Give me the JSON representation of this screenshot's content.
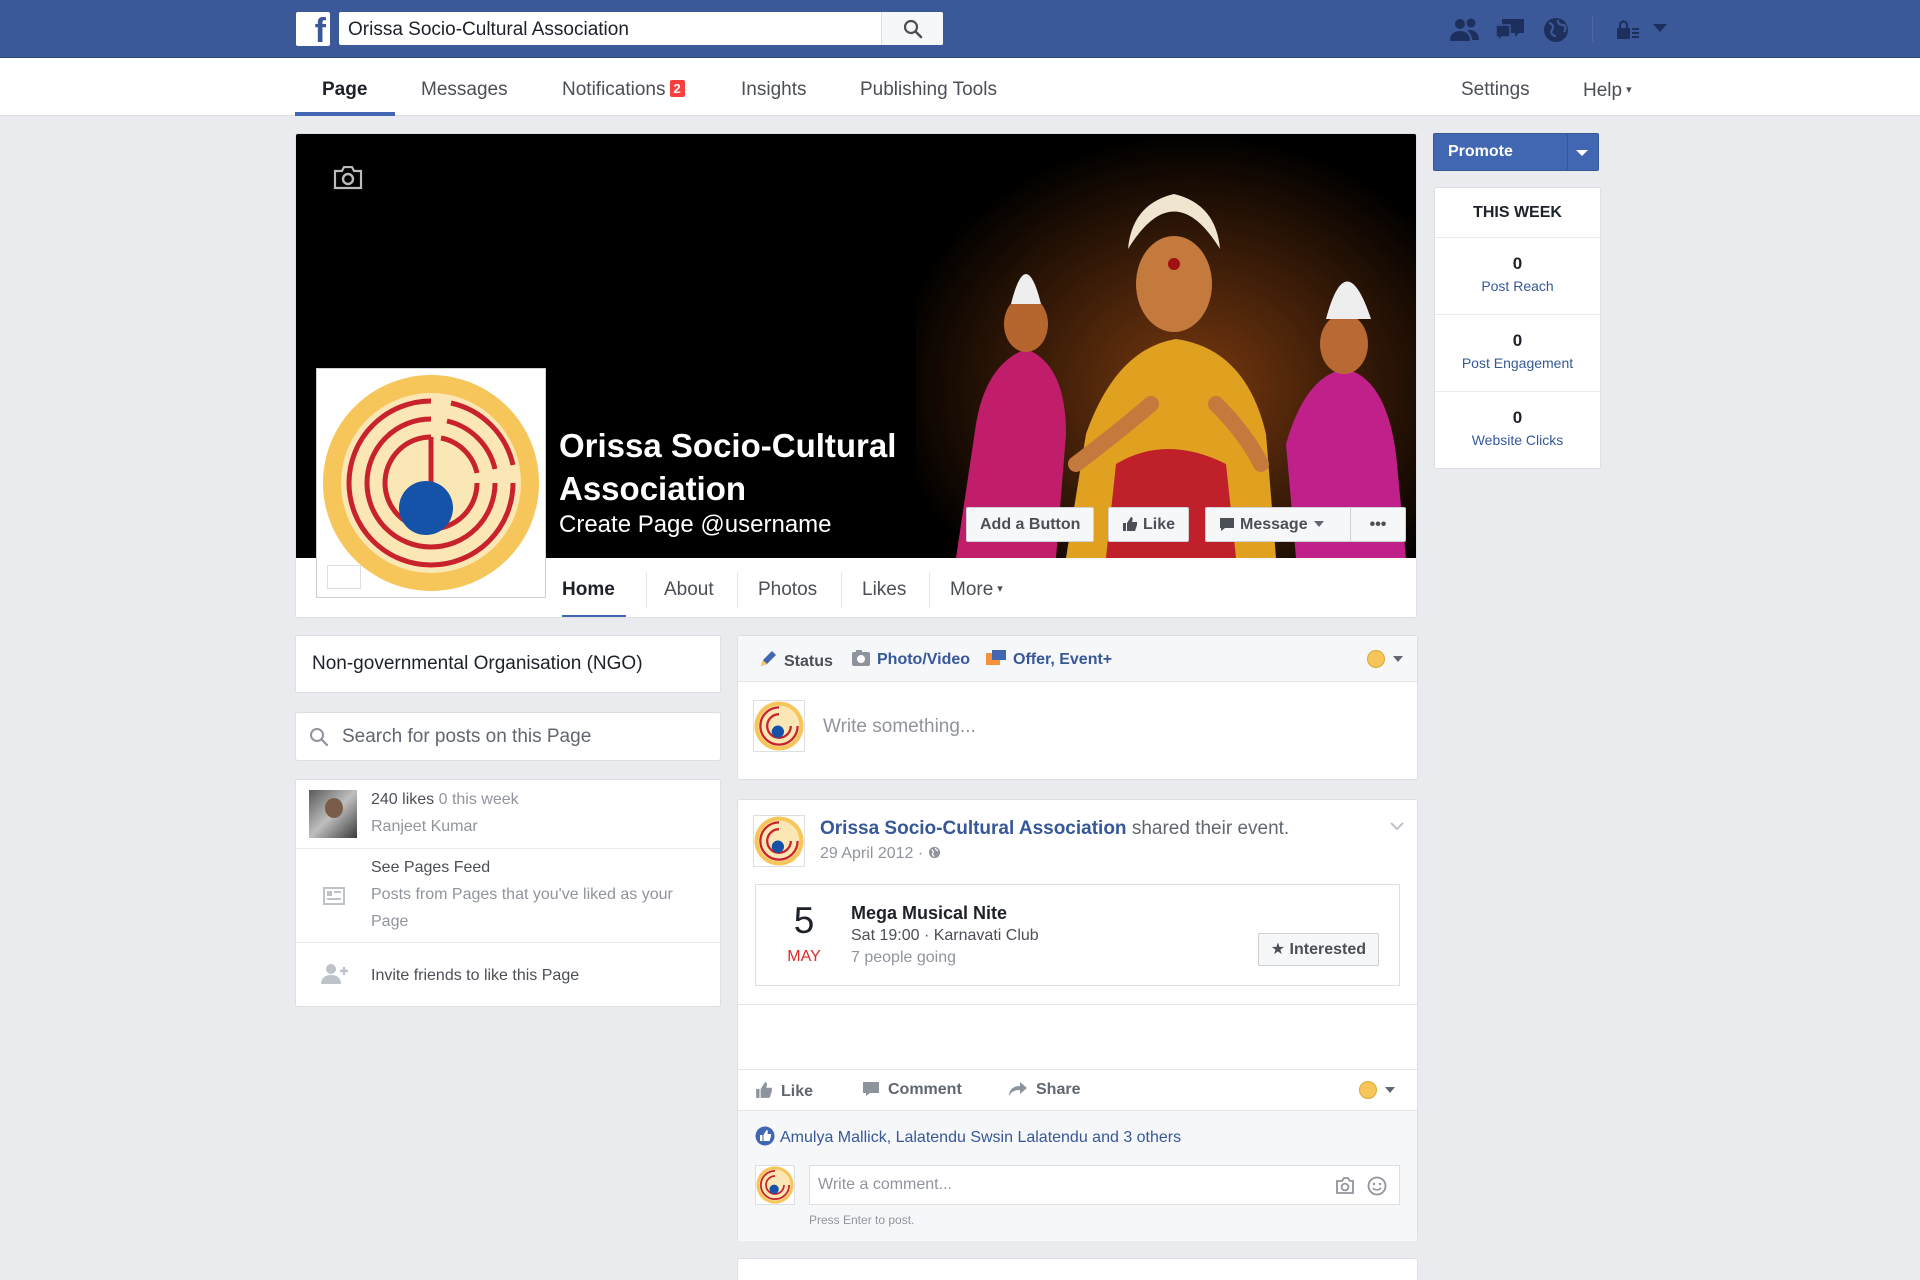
{
  "topbar": {
    "logo": "f",
    "search_value": "Orissa Socio-Cultural Association",
    "icons": [
      "friends-icon",
      "messages-icon",
      "globe-icon",
      "privacy-icon",
      "account-menu-icon"
    ]
  },
  "nav": {
    "tabs": [
      {
        "label": "Page",
        "active": true
      },
      {
        "label": "Messages"
      },
      {
        "label": "Notifications",
        "badge": "2"
      },
      {
        "label": "Insights"
      },
      {
        "label": "Publishing Tools"
      }
    ],
    "settings": "Settings",
    "help": "Help",
    "help_caret": "▾"
  },
  "cover": {
    "title": "Orissa Socio-Cultural Association",
    "username_cta": "Create Page @username",
    "buttons": {
      "add_button": "Add a Button",
      "like": "Like",
      "message": "Message",
      "more": "•••"
    }
  },
  "page_tabs": [
    {
      "label": "Home",
      "active": true
    },
    {
      "label": "About"
    },
    {
      "label": "Photos"
    },
    {
      "label": "Likes"
    },
    {
      "label": "More"
    }
  ],
  "page_tabs_caret": "▾",
  "right": {
    "promote": "Promote",
    "week_header": "THIS WEEK",
    "stats": [
      {
        "value": "0",
        "label": "Post Reach"
      },
      {
        "value": "0",
        "label": "Post Engagement"
      },
      {
        "value": "0",
        "label": "Website Clicks"
      }
    ]
  },
  "left": {
    "category": "Non-governmental Organisation (NGO)",
    "search_placeholder": "Search for posts on this Page",
    "likes_count": "240 likes",
    "likes_week": "0 this week",
    "liker": "Ranjeet Kumar",
    "feed_title": "See Pages Feed",
    "feed_desc": "Posts from Pages that you've liked as your Page",
    "invite": "Invite friends to like this Page"
  },
  "composer": {
    "status": "Status",
    "photo_video": "Photo/Video",
    "offer_event": "Offer, Event+",
    "placeholder": "Write something..."
  },
  "post": {
    "author": "Orissa Socio-Cultural Association",
    "action": "shared their event.",
    "date": "29 April 2012 ·",
    "event": {
      "day": "5",
      "month": "MAY",
      "title": "Mega Musical Nite",
      "time": "Sat 19:00 · Karnavati Club",
      "going": "7 people going",
      "interested": "★ Interested"
    },
    "actions": {
      "like": "Like",
      "comment": "Comment",
      "share": "Share"
    },
    "likes_by": "Amulya Mallick, Lalatendu Swsin Lalatendu and 3 others",
    "comment_placeholder": "Write a comment...",
    "comment_hint": "Press Enter to post."
  },
  "colors": {
    "brand_blue": "#3b5998",
    "link_blue": "#365899",
    "button_blue": "#4267b2",
    "badge_red": "#fa3e3e",
    "event_month_red": "#e02828",
    "logo_gold": "#f6c65a",
    "logo_red": "#c8232c",
    "logo_blue": "#1553a8"
  }
}
